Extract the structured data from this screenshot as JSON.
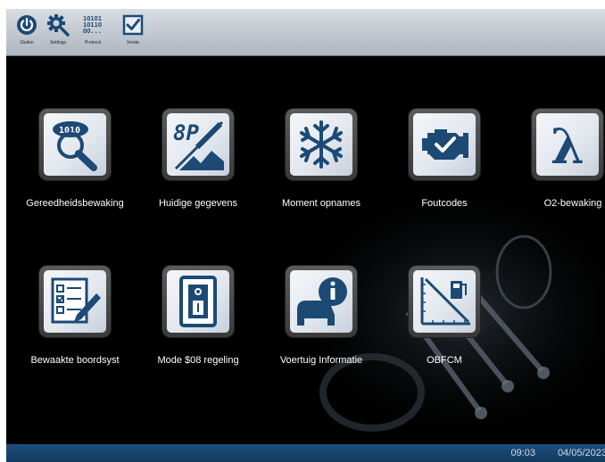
{
  "toolbar": {
    "buttons": [
      {
        "label": "Sluiten",
        "icon": "power-icon"
      },
      {
        "label": "Settings",
        "icon": "gear-search-icon"
      },
      {
        "label": "Protocol",
        "icon": "binary-icon"
      },
      {
        "label": "Verste",
        "icon": "checkbox-icon"
      }
    ]
  },
  "tiles": [
    {
      "label": "Gereedheidsbewaking",
      "icon": "readiness-monitor-icon"
    },
    {
      "label": "Huidige gegevens",
      "icon": "live-data-icon"
    },
    {
      "label": "Moment opnames",
      "icon": "snowflake-icon"
    },
    {
      "label": "Foutcodes",
      "icon": "engine-check-icon"
    },
    {
      "label": "O2-bewaking",
      "icon": "lambda-icon"
    },
    {
      "label": "Bewaakte boordsyst",
      "icon": "checklist-icon"
    },
    {
      "label": "Mode $08 regeling",
      "icon": "switch-icon"
    },
    {
      "label": "Voertuig Informatie",
      "icon": "vehicle-info-icon"
    },
    {
      "label": "OBFCM",
      "icon": "fuel-chart-icon"
    }
  ],
  "status": {
    "time": "09:03",
    "date": "04/05/2023"
  },
  "colors": {
    "toolbar": "#c4cad2",
    "background": "#000000",
    "icon_blue": "#1c4a74",
    "statusbar": "#1a4570"
  }
}
